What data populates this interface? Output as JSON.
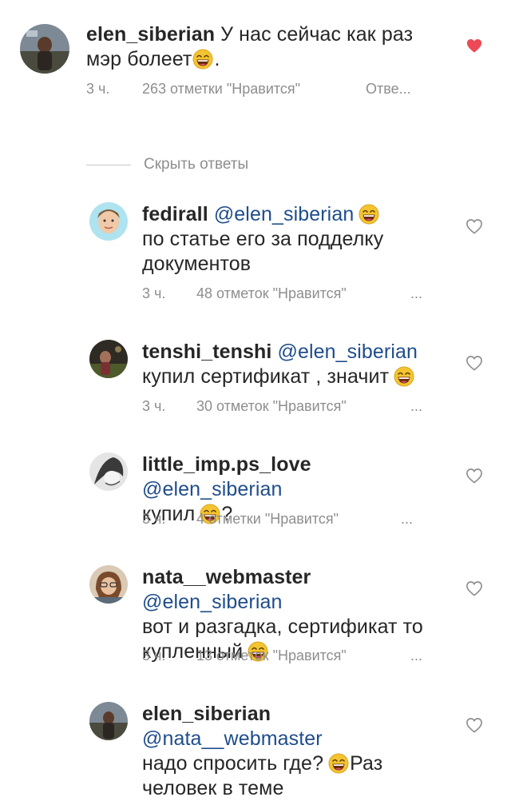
{
  "comments": [
    {
      "username": "elen_siberian",
      "mention": "",
      "text_lines": [
        "У нас сейчас как раз",
        "мэр болеет"
      ],
      "trailing": ".",
      "time": "3 ч.",
      "likes": "263 отметки \"Нравится\"",
      "reply": "Отве...",
      "liked": true,
      "avatar_icon": "avatar-photo"
    },
    {
      "username": "fedirall",
      "mention": "@elen_siberian",
      "text_lines": [
        "по статье его за подделку",
        "документов"
      ],
      "time": "3 ч.",
      "likes": "48 отметок \"Нравится\"",
      "more": "...",
      "liked": false
    },
    {
      "username": "tenshi_tenshi",
      "mention": "@elen_siberian",
      "text_lines": [
        "купил сертификат , значит"
      ],
      "time": "3 ч.",
      "likes": "30 отметок \"Нравится\"",
      "more": "...",
      "liked": false
    },
    {
      "username": "little_imp.ps_love",
      "mention": "@elen_siberian",
      "text_lines": [
        "купил"
      ],
      "trailing": "?",
      "time": "3 ч.",
      "likes": "4 отметки \"Нравится\"",
      "more": "...",
      "liked": false
    },
    {
      "username": "nata__webmaster",
      "mention": "@elen_siberian",
      "text_lines": [
        "вот и разгадка, сертификат то",
        "купленный"
      ],
      "time": "3 ч.",
      "likes": "13 отметок \"Нравится\"",
      "more": "...",
      "liked": false
    },
    {
      "username": "elen_siberian",
      "mention": "@nata__webmaster",
      "text_lines": [
        "надо спросить где?",
        "Раз",
        "человек в теме"
      ],
      "liked": false
    }
  ],
  "hide_replies": "Скрыть ответы",
  "colors": {
    "liked_heart": "#ed4956",
    "mention": "#1f4d8c",
    "meta": "#8e8e8e"
  }
}
